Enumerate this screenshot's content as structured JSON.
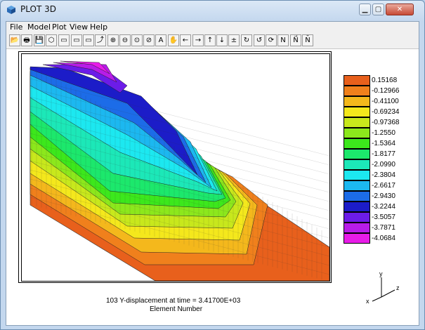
{
  "window": {
    "title": "PLOT 3D"
  },
  "menu": [
    "File",
    "Model",
    "Plot",
    "View",
    "Help"
  ],
  "toolbar": {
    "icons": [
      "open-icon",
      "print-icon",
      "save-icon",
      "cube-icon",
      "panel-1-icon",
      "panel-2-icon",
      "panel-3-icon",
      "rotate-icon",
      "zoom-in-icon",
      "zoom-out-icon",
      "zoom-fit-icon",
      "zoom-window-icon",
      "text-icon",
      "pan-hand-icon",
      "arrow-left-icon",
      "arrow-right-icon",
      "arrow-up-icon",
      "arrow-down-icon",
      "plus-minus-icon",
      "rotate-x-icon",
      "rotate-y-icon",
      "rotate-z-icon",
      "normal-icon",
      "normal-arrow-icon",
      "normal-bar-icon"
    ],
    "glyphs": [
      "📂",
      "🖶",
      "💾",
      "⬡",
      "▭",
      "▭",
      "▭",
      "⤴",
      "⊕",
      "⊖",
      "⊙",
      "⊘",
      "A",
      "✋",
      "←",
      "→",
      "↑",
      "↓",
      "±",
      "↻",
      "↺",
      "⟳",
      "N",
      "N⃗",
      "N̄"
    ]
  },
  "plot": {
    "caption_line1": "103  Y-displacement at time =   3.41700E+03",
    "caption_line2": "Element Number"
  },
  "legend": {
    "colors": [
      "#e8601c",
      "#f0801c",
      "#f4b81c",
      "#f4e81c",
      "#c8e81c",
      "#8ce81c",
      "#3ce81c",
      "#1ce86c",
      "#1ce8b8",
      "#1ce8f0",
      "#1cb8f0",
      "#1c6ce8",
      "#1c1cc8",
      "#6c1ce8",
      "#b81ce8",
      "#e81ce8"
    ],
    "labels": [
      "0.15168",
      "-0.12966",
      "-0.41100",
      "-0.69234",
      "-0.97368",
      "-1.2550",
      "-1.5364",
      "-1.8177",
      "-2.0990",
      "-2.3804",
      "-2.6617",
      "-2.9430",
      "-3.2244",
      "-3.5057",
      "-3.7871",
      "-4.0684"
    ]
  },
  "axes": {
    "x": "x",
    "y": "y",
    "z": "z"
  }
}
